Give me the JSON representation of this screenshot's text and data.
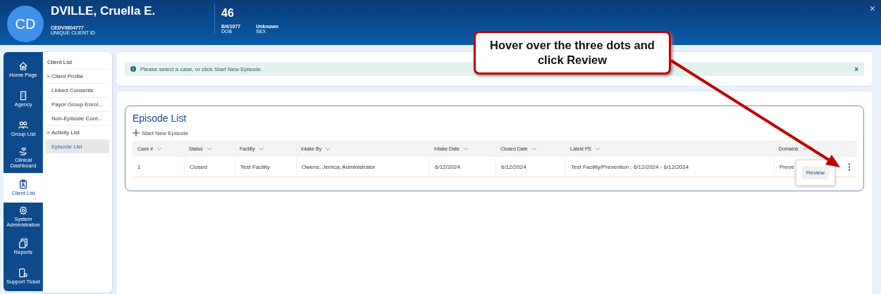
{
  "header": {
    "initials": "CD",
    "name": "DVILLE, Cruella E.",
    "client_id": "CEDV0804777",
    "client_id_label": "UNIQUE CLIENT ID",
    "age": "46",
    "dob": "8/4/1977",
    "dob_label": "DOB",
    "sex": "Unknown",
    "sex_label": "SEX",
    "close": "×"
  },
  "nav": {
    "items": [
      {
        "label": "Home Page",
        "selected": false
      },
      {
        "label": "Agency",
        "selected": false
      },
      {
        "label": "Group List",
        "selected": false
      },
      {
        "label": "Clinical Dashboard",
        "selected": false
      },
      {
        "label": "Client List",
        "selected": true
      },
      {
        "label": "System Administration",
        "selected": false
      },
      {
        "label": "Reports",
        "selected": false
      },
      {
        "label": "Support Ticket",
        "selected": false
      }
    ]
  },
  "submenu": {
    "title": "Client List",
    "items": [
      {
        "label": "Client Profile",
        "chevron": ">",
        "selected": false
      },
      {
        "label": "Linked Consents",
        "selected": false
      },
      {
        "label": "Payor Group Enrol...",
        "selected": false
      },
      {
        "label": "Non-Episode Cont...",
        "selected": false
      },
      {
        "label": "Activity List",
        "chevron": ">",
        "selected": false
      },
      {
        "label": "Episode List",
        "selected": true
      }
    ]
  },
  "alert": {
    "text": "Please select a case, or click Start New Episode.",
    "close": "×"
  },
  "episode_list": {
    "title": "Episode List",
    "add_action": "Start New Episode",
    "columns": [
      "Case #",
      "Status",
      "Facility",
      "Intake By",
      "Intake Date",
      "Closed Date",
      "Latest PE",
      "Domains"
    ],
    "rows": [
      {
        "cells": [
          "1",
          "Closed",
          "Test Facility",
          "Owens, Jerrica; Administrator",
          "6/12/2024",
          "6/12/2024",
          "Test Facility/Prevention : 6/12/2024 - 6/12/2024",
          "Preve"
        ]
      }
    ],
    "row_menu": {
      "items": [
        "Review"
      ]
    }
  },
  "callout": {
    "text": "Hover over the three dots and click Review"
  }
}
